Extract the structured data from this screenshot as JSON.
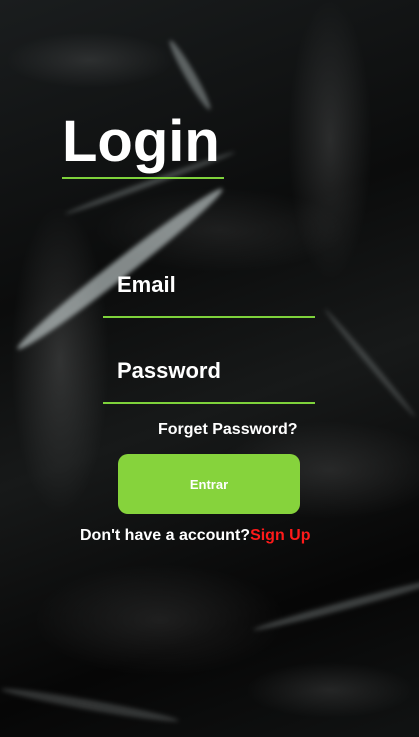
{
  "login": {
    "title": "Login",
    "email_label": "Email",
    "password_label": "Password",
    "forgot_link": "Forget Password?",
    "submit_label": "Entrar",
    "signup_prompt": "Don't have a account?",
    "signup_link": "Sign Up"
  },
  "colors": {
    "accent": "#7ed23b",
    "button": "#86d33c",
    "signup_link": "#ff1a1a",
    "text": "#ffffff"
  }
}
